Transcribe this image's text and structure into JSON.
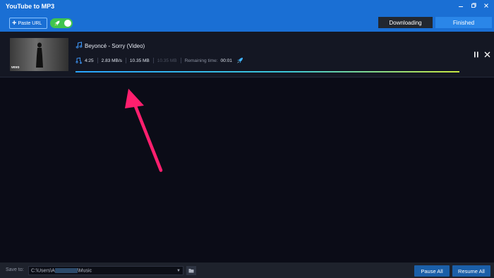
{
  "app": {
    "title": "YouTube to MP3"
  },
  "toolbar": {
    "paste_url_label": "Paste URL",
    "tabs": [
      {
        "label": "Downloading",
        "active": true
      },
      {
        "label": "Finished",
        "active": false
      }
    ]
  },
  "download": {
    "title": "Beyoncé - Sorry (Video)",
    "thumbnail_logo": "vevo",
    "duration": "4:25",
    "speed": "2.83 MB/s",
    "size": "10.35 MB",
    "downloaded": "10.35 MB",
    "remaining_label": "Remaining time:",
    "remaining_value": "00:01",
    "progress": 1.0
  },
  "footer": {
    "save_to_label": "Save to:",
    "path_prefix": "C:\\Users\\A",
    "path_suffix": "\\Music",
    "pause_all_label": "Pause All",
    "resume_all_label": "Resume All"
  },
  "colors": {
    "accent": "#1a6fd4",
    "toggle": "#3fc44f",
    "annotation_arrow": "#ff1f6e"
  },
  "icons": [
    "plus-icon",
    "rocket-icon",
    "music-note-icon",
    "download-icon",
    "pause-icon",
    "close-icon",
    "folder-icon",
    "chevron-down-icon",
    "minimize-icon",
    "restore-icon",
    "window-close-icon"
  ]
}
